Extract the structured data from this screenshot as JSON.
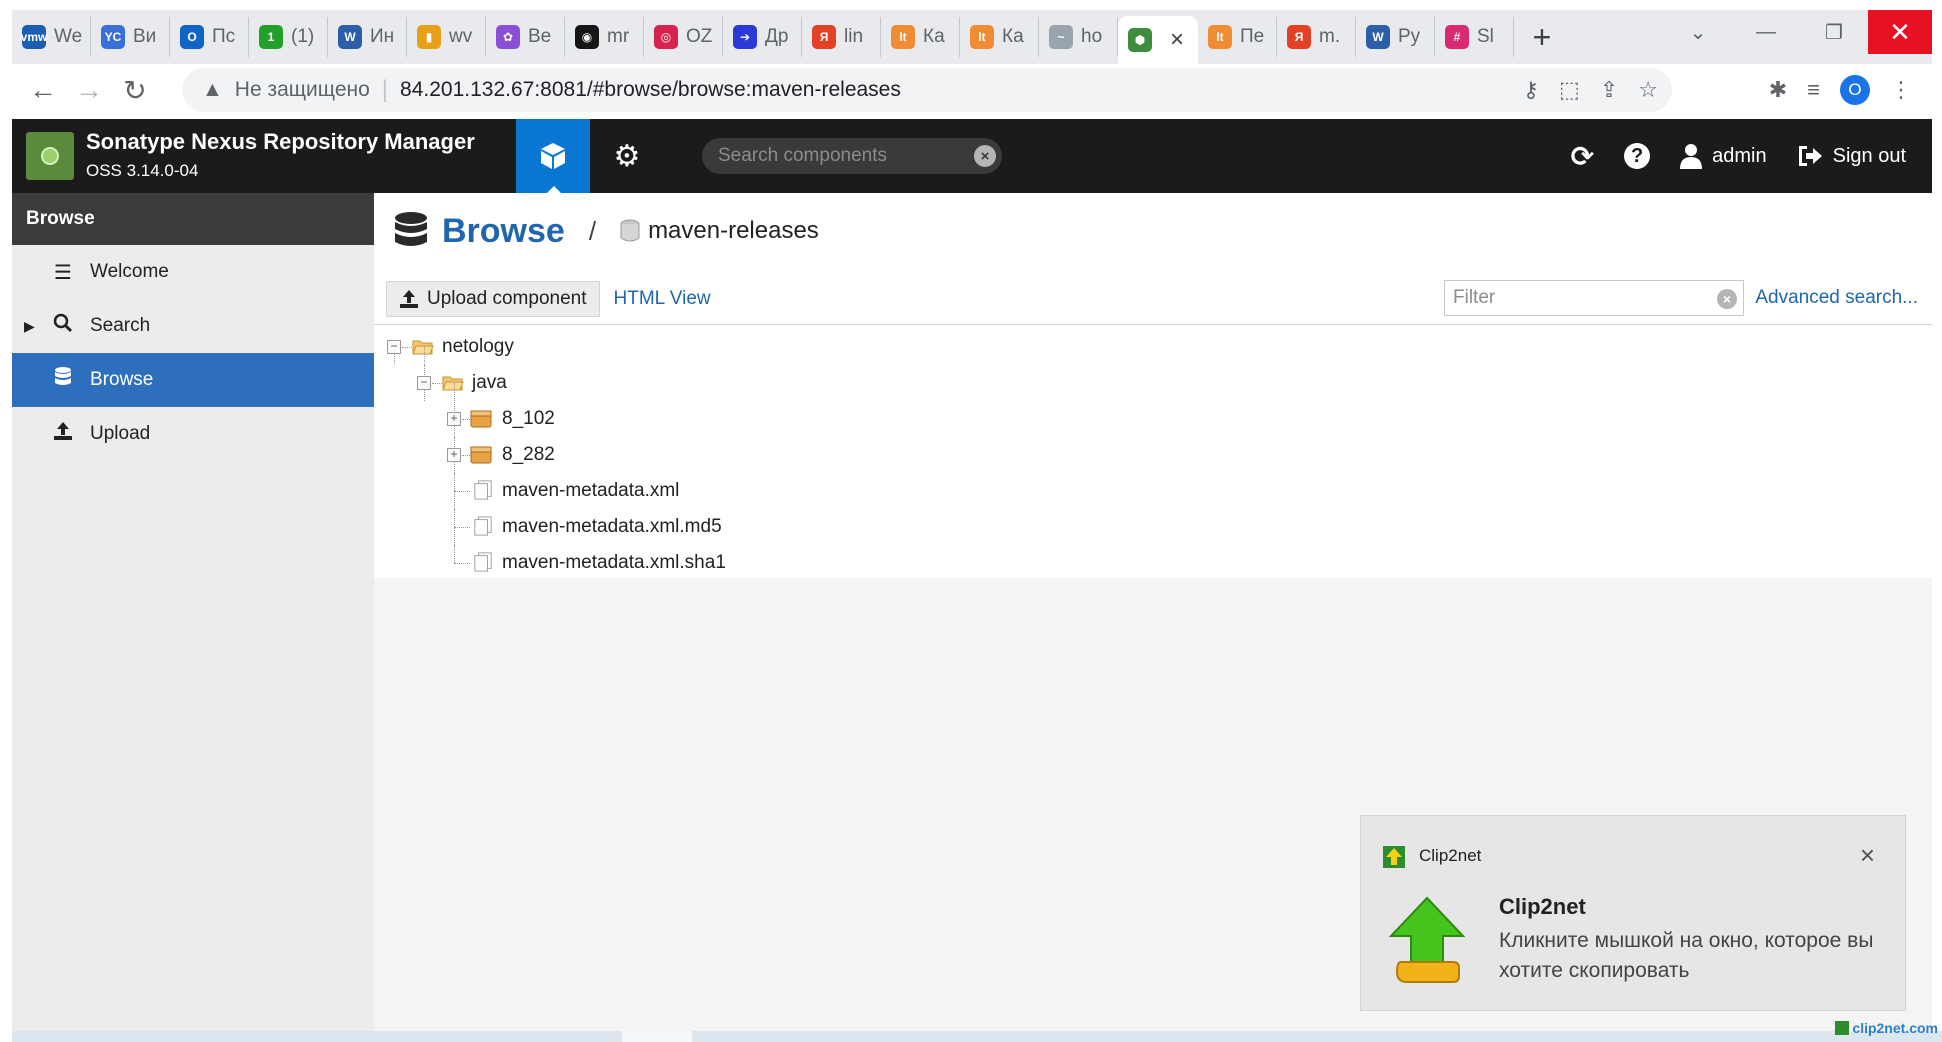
{
  "browser": {
    "tabs": [
      {
        "label": "We",
        "fav_text": "vmw",
        "fav_color": "#1c5eb4"
      },
      {
        "label": "Ви",
        "fav_text": "YC",
        "fav_color": "#3a6fd8"
      },
      {
        "label": "Пс",
        "fav_text": "O",
        "fav_color": "#0f64c4"
      },
      {
        "label": "(1)",
        "fav_text": "1",
        "fav_color": "#22a02a"
      },
      {
        "label": "Ин",
        "fav_text": "W",
        "fav_color": "#2d5ea8"
      },
      {
        "label": "wv",
        "fav_text": "▮",
        "fav_color": "#e8a01a"
      },
      {
        "label": "Be",
        "fav_text": "✿",
        "fav_color": "#8a4fd6"
      },
      {
        "label": "mr",
        "fav_text": "◉",
        "fav_color": "#161616"
      },
      {
        "label": "OZ",
        "fav_text": "◎",
        "fav_color": "#d6234f"
      },
      {
        "label": "Др",
        "fav_text": "➔",
        "fav_color": "#2b3ad6"
      },
      {
        "label": "lin",
        "fav_text": "Я",
        "fav_color": "#e34126"
      },
      {
        "label": "Ка",
        "fav_text": "lt",
        "fav_color": "#f08c33"
      },
      {
        "label": "Ка",
        "fav_text": "lt",
        "fav_color": "#f08c33"
      },
      {
        "label": "ho",
        "fav_text": "~",
        "fav_color": "#9aa4ad"
      },
      {
        "label": "",
        "fav_text": "⬢",
        "fav_color": "#3e8d3e",
        "active": true
      },
      {
        "label": "Пе",
        "fav_text": "lt",
        "fav_color": "#f08c33"
      },
      {
        "label": "m.",
        "fav_text": "Я",
        "fav_color": "#e34126"
      },
      {
        "label": "Py",
        "fav_text": "W",
        "fav_color": "#2d5ea8"
      },
      {
        "label": "Sl",
        "fav_text": "#",
        "fav_color": "#d82a6e"
      }
    ],
    "new_tab": "+",
    "address": {
      "security": "Не защищено",
      "url": "84.201.132.67:8081/#browse/browse:maven-releases"
    },
    "profile_initial": "O"
  },
  "nexus": {
    "title": "Sonatype Nexus Repository Manager",
    "version": "OSS 3.14.0-04",
    "search_placeholder": "Search components",
    "user": "admin",
    "sign_out": "Sign out"
  },
  "sidebar": {
    "header": "Browse",
    "items": [
      {
        "label": "Welcome"
      },
      {
        "label": "Search"
      },
      {
        "label": "Browse"
      },
      {
        "label": "Upload"
      }
    ]
  },
  "main": {
    "breadcrumb_title": "Browse",
    "breadcrumb_sep": "/",
    "repository": "maven-releases",
    "upload_label": "Upload component",
    "html_view_label": "HTML View",
    "filter_placeholder": "Filter",
    "advanced_search": "Advanced search...",
    "tree": [
      {
        "label": "netology",
        "type": "folder-open",
        "toggle": "−"
      },
      {
        "label": "java",
        "type": "folder-open",
        "toggle": "−"
      },
      {
        "label": "8_102",
        "type": "component",
        "toggle": "+"
      },
      {
        "label": "8_282",
        "type": "component",
        "toggle": "+"
      },
      {
        "label": "maven-metadata.xml",
        "type": "file"
      },
      {
        "label": "maven-metadata.xml.md5",
        "type": "file"
      },
      {
        "label": "maven-metadata.xml.sha1",
        "type": "file"
      }
    ]
  },
  "notification": {
    "app_name": "Clip2net",
    "title": "Clip2net",
    "body": "Кликните мышкой на окно, которое вы хотите скопировать"
  },
  "watermark": "clip2net.com"
}
